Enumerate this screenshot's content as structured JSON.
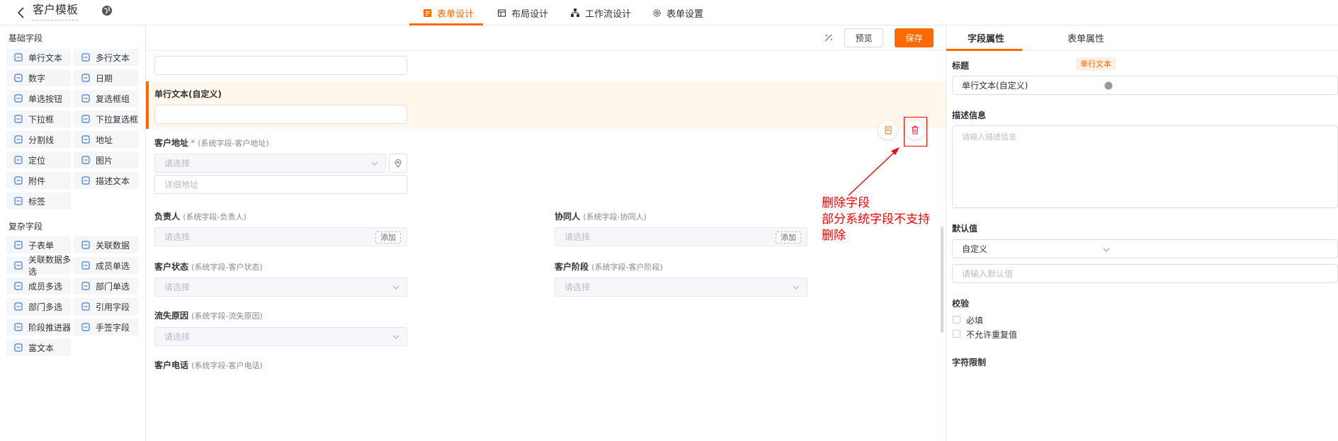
{
  "header": {
    "title": "客户模板",
    "tabs": [
      {
        "label": "表单设计",
        "active": true
      },
      {
        "label": "布局设计",
        "active": false
      },
      {
        "label": "工作流设计",
        "active": false
      },
      {
        "label": "表单设置",
        "active": false
      }
    ]
  },
  "left_panel": {
    "basic_title": "基础字段",
    "basic_fields": [
      {
        "label": "单行文本",
        "icon": "text-icon"
      },
      {
        "label": "多行文本",
        "icon": "textarea-icon"
      },
      {
        "label": "数字",
        "icon": "number-icon"
      },
      {
        "label": "日期",
        "icon": "calendar-icon"
      },
      {
        "label": "单选按钮",
        "icon": "radio-icon"
      },
      {
        "label": "复选框组",
        "icon": "checkbox-icon"
      },
      {
        "label": "下拉框",
        "icon": "dropdown-icon"
      },
      {
        "label": "下拉复选框",
        "icon": "dropdown-multi-icon"
      },
      {
        "label": "分割线",
        "icon": "divider-icon"
      },
      {
        "label": "地址",
        "icon": "location-icon"
      },
      {
        "label": "定位",
        "icon": "crosshair-icon"
      },
      {
        "label": "图片",
        "icon": "image-icon"
      },
      {
        "label": "附件",
        "icon": "paperclip-icon"
      },
      {
        "label": "描述文本",
        "icon": "description-icon"
      },
      {
        "label": "标签",
        "icon": "tag-icon"
      }
    ],
    "complex_title": "复杂字段",
    "complex_fields": [
      {
        "label": "子表单",
        "icon": "subform-icon"
      },
      {
        "label": "关联数据",
        "icon": "link-data-icon"
      },
      {
        "label": "关联数据多选",
        "icon": "link-multi-icon"
      },
      {
        "label": "成员单选",
        "icon": "user-icon"
      },
      {
        "label": "成员多选",
        "icon": "users-icon"
      },
      {
        "label": "部门单选",
        "icon": "org-icon"
      },
      {
        "label": "部门多选",
        "icon": "org-multi-icon"
      },
      {
        "label": "引用字段",
        "icon": "reference-icon"
      },
      {
        "label": "阶段推进器",
        "icon": "stage-icon"
      },
      {
        "label": "手签字段",
        "icon": "signature-icon"
      },
      {
        "label": "富文本",
        "icon": "richtext-icon"
      }
    ]
  },
  "toolbar": {
    "preview_label": "预览",
    "save_label": "保存"
  },
  "form": {
    "selected_field": {
      "label": "单行文本(自定义)"
    },
    "address": {
      "label": "客户地址",
      "required_mark": "*",
      "sys": "(系统字段-客户地址)",
      "select_placeholder": "请选择",
      "detail_placeholder": "详细地址"
    },
    "owner": {
      "label": "负责人",
      "sys": "(系统字段-负责人)",
      "placeholder": "请选择",
      "add_label": "添加"
    },
    "collaborator": {
      "label": "协同人",
      "sys": "(系统字段-协同人)",
      "placeholder": "请选择",
      "add_label": "添加"
    },
    "status": {
      "label": "客户状态",
      "sys": "(系统字段-客户状态)",
      "placeholder": "请选择"
    },
    "stage": {
      "label": "客户阶段",
      "sys": "(系统字段-客户阶段)",
      "placeholder": "请选择"
    },
    "loss_reason": {
      "label": "流失原因",
      "sys": "(系统字段-流失原因)",
      "placeholder": "请选择"
    },
    "phone": {
      "label": "客户电话",
      "sys": "(系统字段-客户电话)"
    }
  },
  "annotation": {
    "text": "删除字段\n部分系统字段不支持\n删除",
    "color": "#ff0000"
  },
  "right_panel": {
    "tabs": [
      {
        "label": "字段属性",
        "active": true
      },
      {
        "label": "表单属性",
        "active": false
      }
    ],
    "title_label": "标题",
    "type_tag": "单行文本",
    "title_value": "单行文本(自定义)",
    "desc_label": "描述信息",
    "desc_placeholder": "请输入描述信息",
    "default_label": "默认值",
    "default_type": "自定义",
    "default_placeholder": "请输入默认值",
    "validate_label": "校验",
    "required_label": "必填",
    "no_dup_label": "不允许重复值",
    "limit_label": "字符限制"
  },
  "colors": {
    "accent": "#ff6a00",
    "selected_bg": "#fff6ec"
  }
}
